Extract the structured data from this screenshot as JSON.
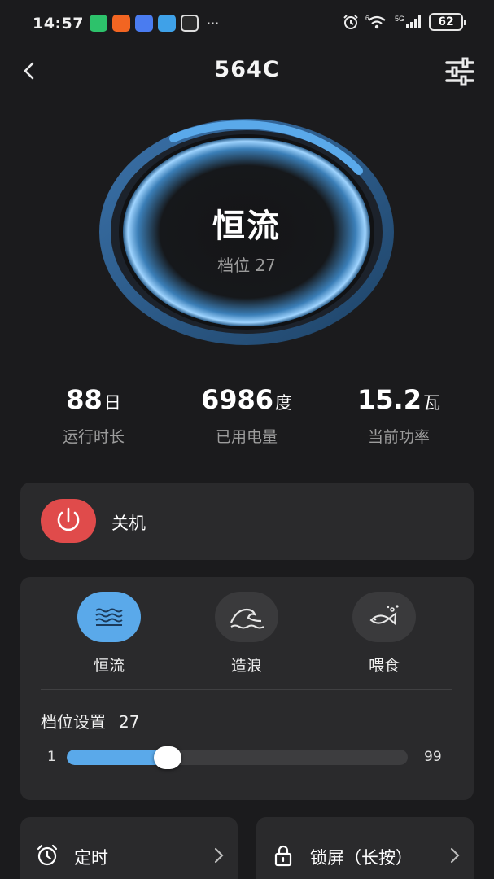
{
  "status_bar": {
    "time": "14:57",
    "more_dots": "···",
    "battery": "62",
    "network": "5G",
    "wifi_tag": "6"
  },
  "header": {
    "title": "564C"
  },
  "dial": {
    "mode": "恒流",
    "level_text": "档位 27",
    "progress_fraction": 0.27
  },
  "stats": [
    {
      "value": "88",
      "unit": "日",
      "label": "运行时长"
    },
    {
      "value": "6986",
      "unit": "度",
      "label": "已用电量"
    },
    {
      "value": "15.2",
      "unit": "瓦",
      "label": "当前功率"
    }
  ],
  "power": {
    "label": "关机"
  },
  "modes": [
    {
      "label": "恒流",
      "icon": "waves-icon",
      "active": true
    },
    {
      "label": "造浪",
      "icon": "wave-crest-icon",
      "active": false
    },
    {
      "label": "喂食",
      "icon": "fish-icon",
      "active": false
    }
  ],
  "level": {
    "title": "档位设置",
    "value": "27",
    "min": "1",
    "max": "99",
    "current": 27
  },
  "timer": {
    "label": "定时"
  },
  "lock": {
    "label": "锁屏（长按）"
  },
  "colors": {
    "background": "#1b1b1d",
    "card": "#2a2a2c",
    "accent": "#5aa9ea",
    "power": "#e04b4b"
  }
}
